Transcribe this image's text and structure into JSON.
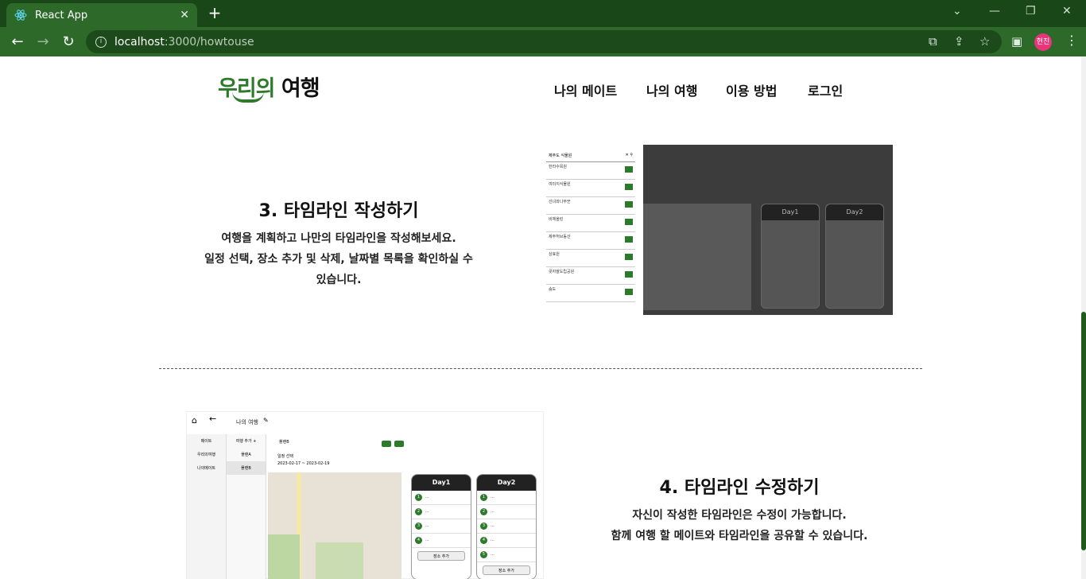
{
  "browser": {
    "tab_title": "React App",
    "url_host": "localhost",
    "url_path": ":3000/howtouse",
    "profile_initials": "현진"
  },
  "header": {
    "logo_part1": "우리의",
    "logo_part2": " 여행",
    "menu": [
      "나의 메이트",
      "나의 여행",
      "이용 방법",
      "로그인"
    ]
  },
  "section3": {
    "title": "3. 타임라인 작성하기",
    "desc1": "여행을 계획하고 나만의 타임라인을 작성해보세요.",
    "desc2": "일정 선택, 장소 추가 및 삭제, 날짜별 목록을 확인하실 수",
    "desc3": "있습니다."
  },
  "section4": {
    "title": "4. 타임라인 수정하기",
    "desc1": "자신이 작성한 타임라인은 수정이 가능합니다.",
    "desc2": "함께 여행 할 메이트와 타임라인을 공유할 수 있습니다."
  },
  "shot1": {
    "search": "제주도 식물원",
    "days": [
      "Day1",
      "Day2"
    ],
    "places": [
      "한라수목원",
      "여미지식물원",
      "선녀와나무꾼",
      "비체올린",
      "제주허브동산",
      "상효원",
      "곶자왈도립공원",
      "숨도"
    ]
  },
  "shot2": {
    "title": "나의 여행",
    "side": [
      "메이트",
      "우리의여행",
      "나의메이트"
    ],
    "side2": [
      "여행 추가 +",
      "플랜A",
      "플랜B"
    ],
    "plan": "플랜B",
    "date_label": "일정 선택",
    "date_range": "2023-02-17 ~ 2023-02-19",
    "days": [
      "Day1",
      "Day2"
    ],
    "add_label": "장소 추가"
  }
}
